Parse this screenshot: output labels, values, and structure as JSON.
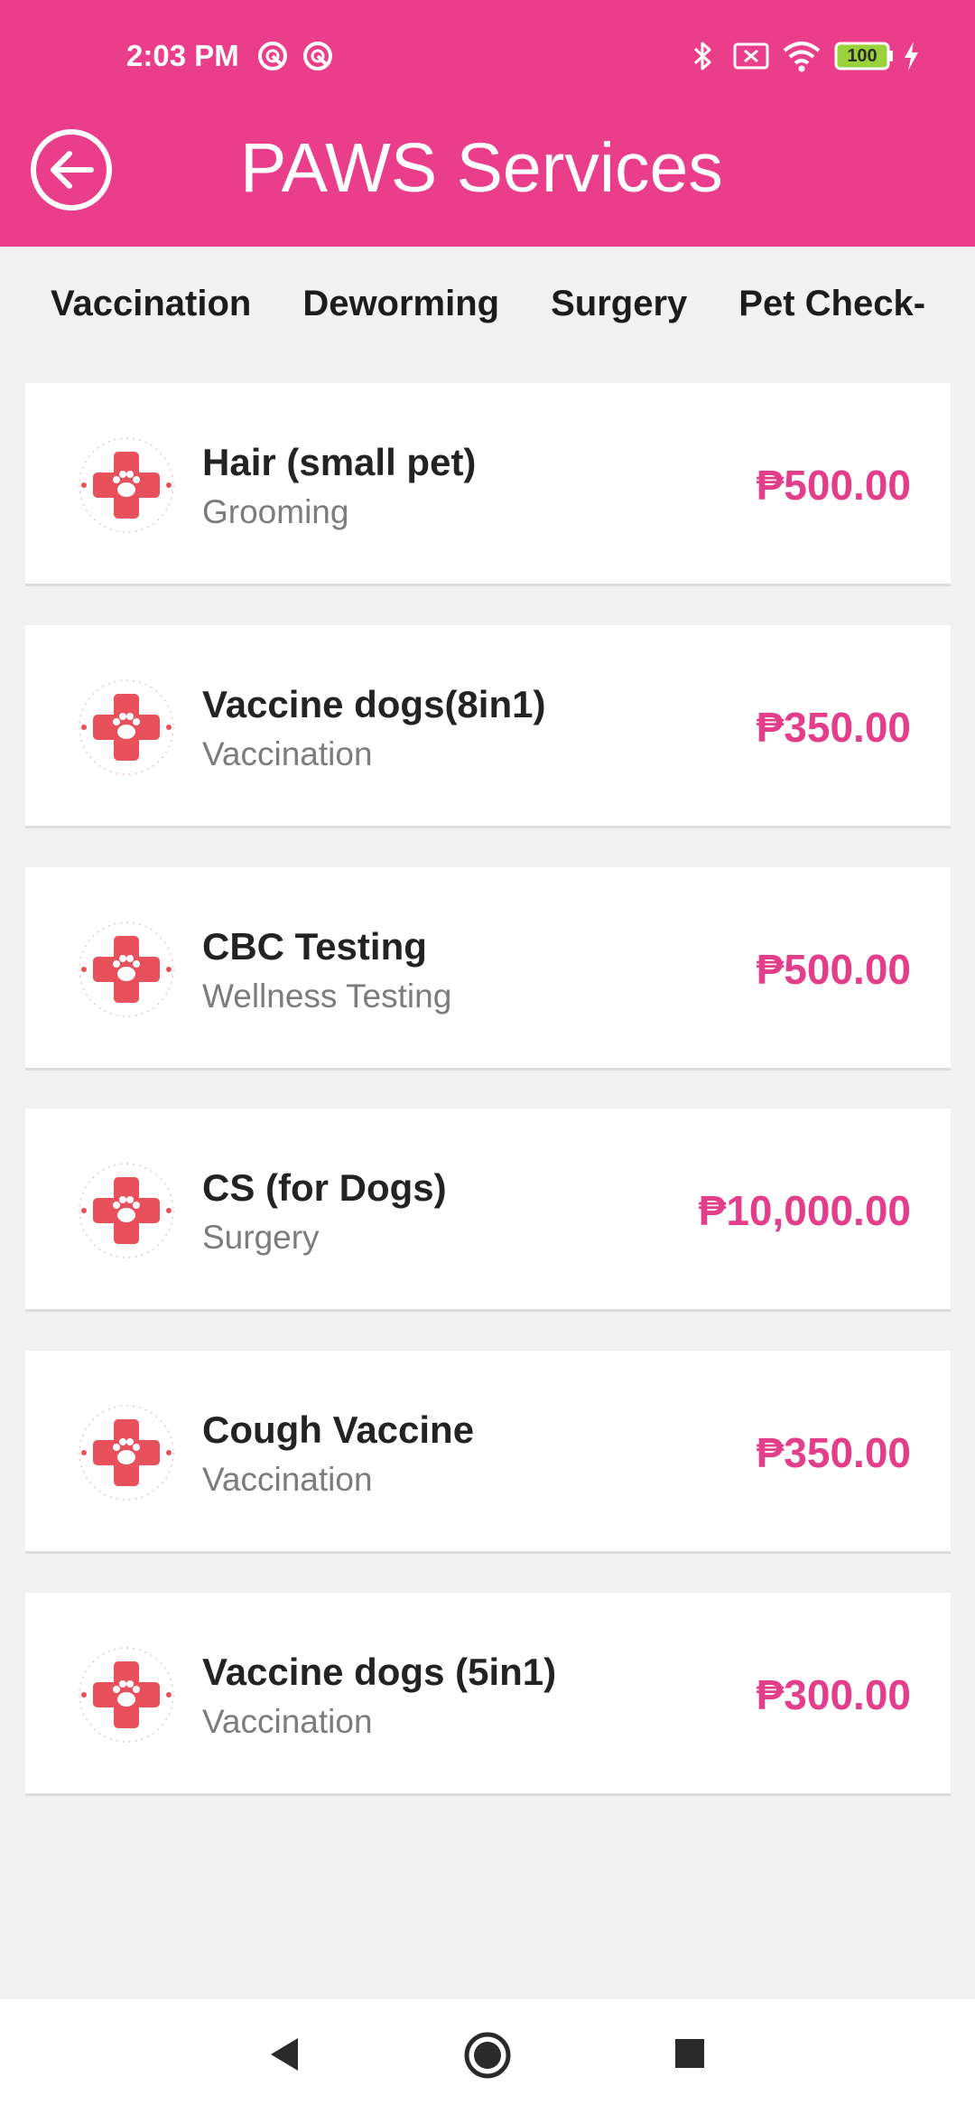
{
  "status_bar": {
    "time": "2:03 PM",
    "battery_level": "100",
    "icons": [
      "sync-icon",
      "sync-icon",
      "bluetooth-icon",
      "sim-off-icon",
      "wifi-icon",
      "battery-icon",
      "charging-icon"
    ]
  },
  "header": {
    "title": "PAWS Services",
    "back_icon": "back-arrow-icon"
  },
  "tabs": [
    {
      "label": "Vaccination"
    },
    {
      "label": "Deworming"
    },
    {
      "label": "Surgery"
    },
    {
      "label": "Pet Check-U"
    }
  ],
  "services": [
    {
      "name": "Hair (small pet)",
      "category": "Grooming",
      "price": "₱500.00",
      "icon": "vet-cross-paw-icon"
    },
    {
      "name": "Vaccine dogs(8in1)",
      "category": "Vaccination",
      "price": "₱350.00",
      "icon": "vet-cross-paw-icon"
    },
    {
      "name": "CBC Testing",
      "category": "Wellness Testing",
      "price": "₱500.00",
      "icon": "vet-cross-paw-icon"
    },
    {
      "name": "CS (for Dogs)",
      "category": "Surgery",
      "price": "₱10,000.00",
      "icon": "vet-cross-paw-icon"
    },
    {
      "name": "Cough Vaccine",
      "category": "Vaccination",
      "price": "₱350.00",
      "icon": "vet-cross-paw-icon"
    },
    {
      "name": "Vaccine dogs (5in1)",
      "category": "Vaccination",
      "price": "₱300.00",
      "icon": "vet-cross-paw-icon"
    }
  ],
  "nav_bar": {
    "buttons": [
      "back-triangle-icon",
      "home-circle-icon",
      "recents-square-icon"
    ]
  },
  "colors": {
    "primary": "#ea3e8b",
    "price": "#e23e8a",
    "icon_cross": "#e8505b",
    "background": "#f1f1f1",
    "card": "#ffffff"
  }
}
